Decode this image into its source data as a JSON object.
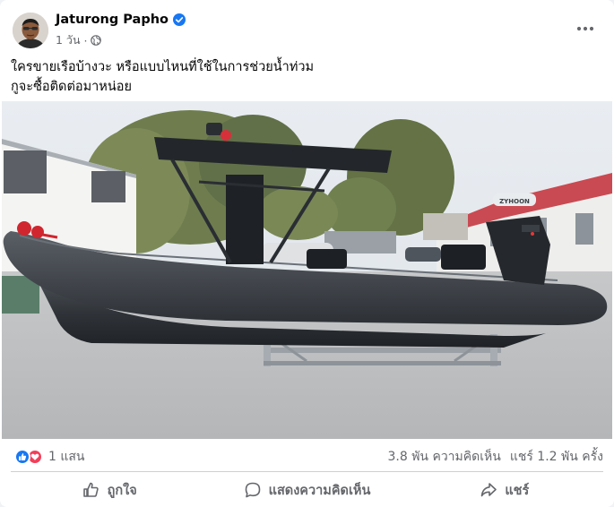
{
  "post": {
    "author": "Jaturong Papho",
    "time": "1 วัน",
    "time_separator": "·",
    "text_lines": [
      "ใครขายเรือบ้างวะ หรือแบบไหนที่ใช้ในการช่วยน้ำท่วม",
      "กูจะซื้อติดต่อมาหน่อย"
    ],
    "image_watermark": "ZYHOON"
  },
  "stats": {
    "reactions_count": "1 แสน",
    "comments": "3.8 พัน ความคิดเห็น",
    "shares": "แชร์ 1.2 พัน ครั้ง"
  },
  "actions": {
    "like": "ถูกใจ",
    "comment": "แสดงความคิดเห็น",
    "share": "แชร์"
  },
  "colors": {
    "accent": "#1877f2",
    "love": "#f33e58",
    "secondary_text": "#65676b"
  },
  "icons": [
    "verified-badge-icon",
    "globe-icon",
    "more-icon",
    "like-reaction-icon",
    "love-reaction-icon",
    "thumbs-up-icon",
    "comment-icon",
    "share-icon"
  ]
}
